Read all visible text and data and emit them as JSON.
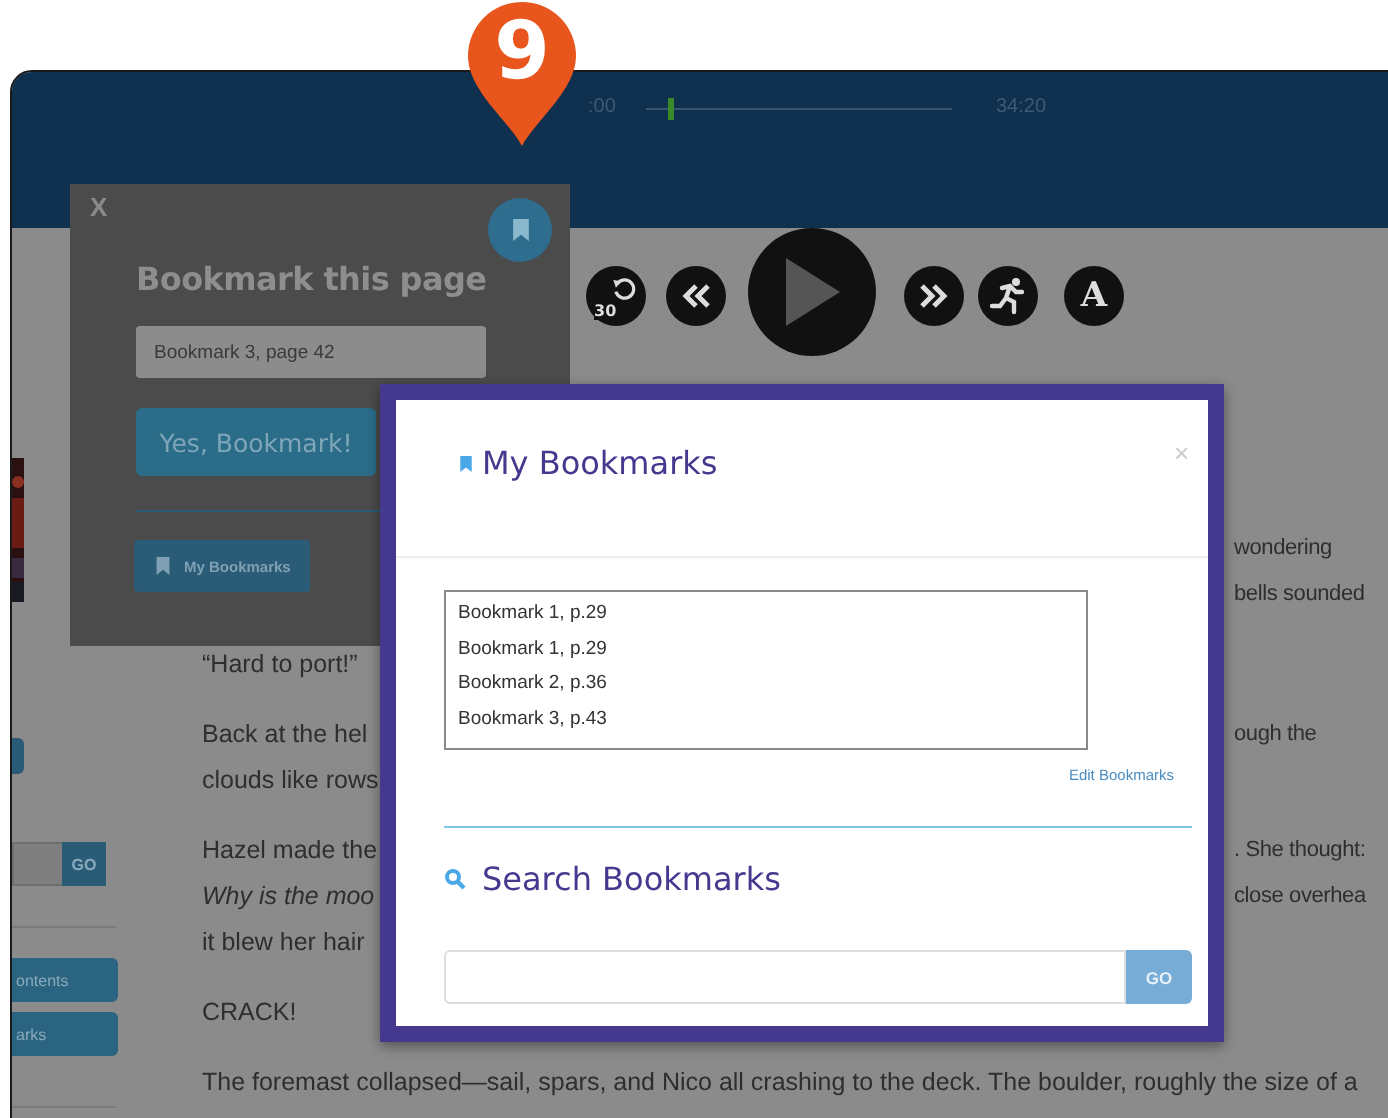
{
  "marker": {
    "label": "9"
  },
  "player": {
    "elapsed": ":00",
    "total": "34:20",
    "level": 0.07,
    "controls": [
      {
        "kind": "replay",
        "label": "30"
      },
      {
        "kind": "rewind"
      },
      {
        "kind": "play"
      },
      {
        "kind": "forward"
      },
      {
        "kind": "speed"
      },
      {
        "kind": "font",
        "label": "A"
      }
    ]
  },
  "sidebar": {
    "search_button": "GO",
    "buttons": [
      {
        "label": "ontents"
      },
      {
        "label": "arks"
      }
    ]
  },
  "story": [
    {
      "lines": [
        [
          {
            "kind": "trailing",
            "text": "wondering",
            "italic": false
          }
        ],
        [
          {
            "kind": "trailing",
            "text": "bells sounded",
            "italic": false
          }
        ]
      ]
    },
    {
      "lines": [
        [
          {
            "kind": "leading",
            "text": "“Hard to port!”",
            "italic": false
          }
        ]
      ]
    },
    {
      "lines": [
        [
          {
            "kind": "leading",
            "text": "Back at the hel",
            "italic": false
          },
          {
            "kind": "trailing",
            "text": "ough the",
            "italic": false
          }
        ],
        [
          {
            "kind": "leading",
            "text": "clouds like rows",
            "italic": false
          }
        ]
      ]
    },
    {
      "lines": [
        [
          {
            "kind": "leading",
            "text": "Hazel made the",
            "italic": false
          },
          {
            "kind": "trailing",
            "text": ". She thought:",
            "italic": false
          }
        ],
        [
          {
            "kind": "leading",
            "text": "Why is the moo",
            "italic": true
          },
          {
            "kind": "trailing",
            "text": "close overhea",
            "italic": false
          }
        ],
        [
          {
            "kind": "leading",
            "text": "it blew her hair",
            "italic": false
          }
        ]
      ]
    },
    {
      "lines": [
        [
          {
            "kind": "leading",
            "text": "CRACK!",
            "italic": false
          }
        ]
      ]
    },
    {
      "lines": [
        [
          {
            "kind": "leading",
            "text": "The foremast collapsed—sail, spars, and Nico all crashing to the deck. The boulder, roughly the size of a",
            "italic": false
          }
        ]
      ]
    }
  ],
  "bookmark_popup": {
    "close": "X",
    "title": "Bookmark this page",
    "name_value": "Bookmark 3, page 42",
    "confirm_button": "Yes, Bookmark!",
    "my_bookmarks_button": "My Bookmarks"
  },
  "bookmarks_modal": {
    "title": "My Bookmarks",
    "close": "×",
    "bookmarks": [
      "Bookmark 1, p.29",
      "Bookmark 1, p.29",
      "Bookmark 2, p.36",
      "Bookmark 3, p.43"
    ],
    "edit_link": "Edit Bookmarks",
    "search_title": "Search Bookmarks",
    "search_button": "GO"
  }
}
